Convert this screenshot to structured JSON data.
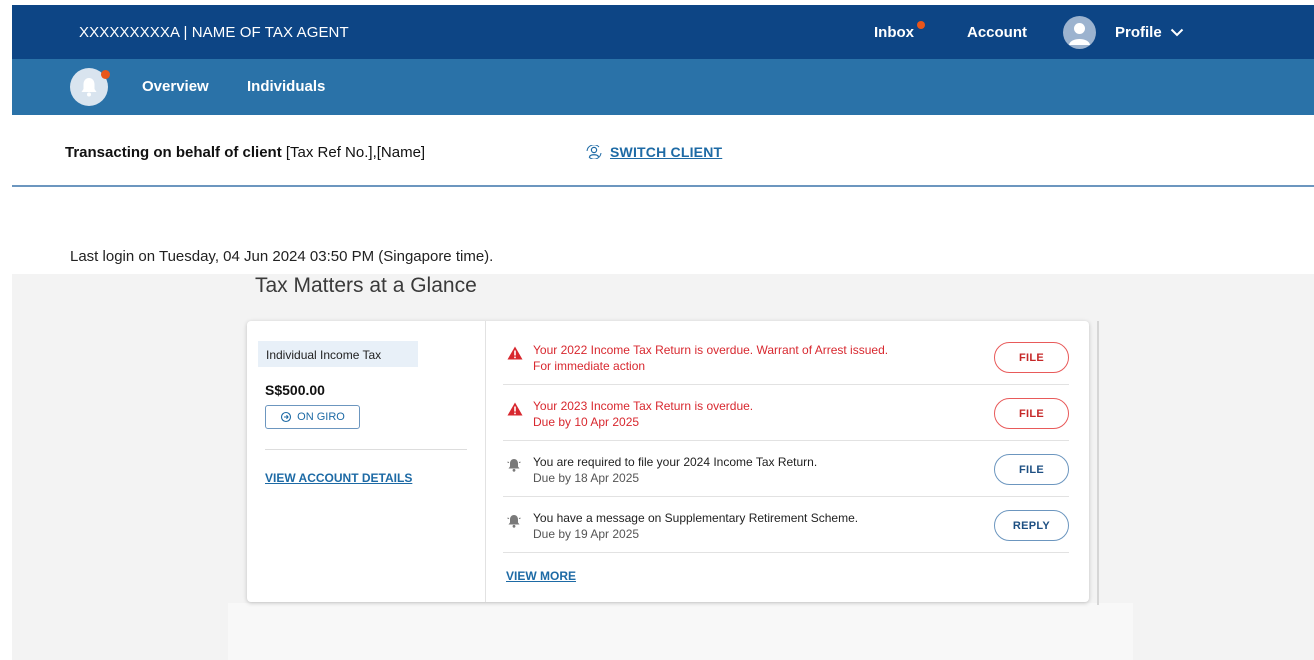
{
  "header": {
    "agent_label": "XXXXXXXXXA | NAME OF TAX AGENT",
    "inbox_label": "Inbox",
    "account_label": "Account",
    "profile_label": "Profile",
    "accent_color": "#0d4585",
    "notification_color": "#e8561b"
  },
  "subnav": {
    "tabs": [
      {
        "label": "Overview"
      },
      {
        "label": "Individuals"
      }
    ],
    "bar_color": "#2a72a8"
  },
  "client": {
    "prefix": "Transacting on behalf of client",
    "details": "[Tax Ref No.],[Name]",
    "switch_label": "SWITCH CLIENT"
  },
  "last_login": "Last login on Tuesday, 04 Jun 2024 03:50 PM (Singapore time).",
  "glance": {
    "title": "Tax Matters at a Glance",
    "summary": {
      "tax_type": "Individual Income Tax",
      "amount": "S$500.00",
      "giro_label": "ON GIRO",
      "view_account_label": "VIEW ACCOUNT DETAILS"
    },
    "notices": [
      {
        "status": "overdue",
        "icon": "warning-icon",
        "line1": "Your 2022 Income Tax Return is overdue. Warrant of Arrest issued.",
        "line2": "For immediate action",
        "action": "FILE"
      },
      {
        "status": "overdue",
        "icon": "warning-icon",
        "line1": "Your 2023 Income Tax Return is overdue.",
        "line2": "Due by 10 Apr 2025",
        "action": "FILE"
      },
      {
        "status": "normal",
        "icon": "bell-icon",
        "line1": "You are required to file your 2024 Income Tax Return.",
        "line2": "Due by 18 Apr 2025",
        "action": "FILE"
      },
      {
        "status": "normal",
        "icon": "bell-icon",
        "line1": "You have a message on Supplementary Retirement Scheme.",
        "line2": "Due by 19 Apr 2025",
        "action": "REPLY"
      }
    ],
    "view_more_label": "VIEW MORE"
  }
}
